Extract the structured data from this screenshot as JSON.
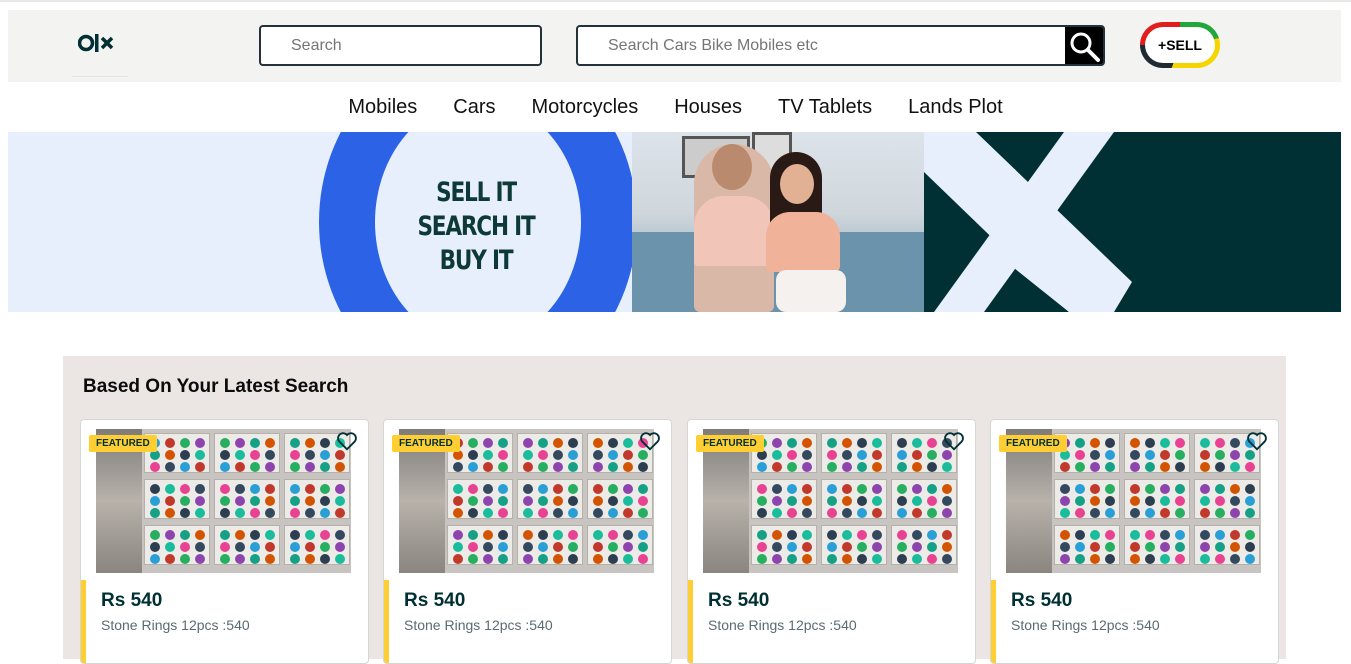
{
  "header": {
    "logo_alt": "OLX",
    "location_placeholder": "Search",
    "search_placeholder": "Search Cars Bike Mobiles etc",
    "sell_label": "+SELL",
    "icons": {
      "logo": "olx-logo-icon",
      "search": "search-icon"
    }
  },
  "categories": [
    "Mobiles",
    "Cars",
    "Motorcycles",
    "Houses",
    "TV Tablets",
    "Lands Plot"
  ],
  "banner": {
    "lines": [
      "SELL IT",
      "SEARCH IT",
      "BUY IT"
    ],
    "colors": {
      "ring": "#2c63e6",
      "background": "#e7effd",
      "x_panel": "#002f34",
      "text": "#0d3a36"
    }
  },
  "section": {
    "title": "Based On Your Latest Search",
    "cards": [
      {
        "badge": "FEATURED",
        "price": "Rs 540",
        "title": "Stone Rings 12pcs :540"
      },
      {
        "badge": "FEATURED",
        "price": "Rs 540",
        "title": "Stone Rings 12pcs :540"
      },
      {
        "badge": "FEATURED",
        "price": "Rs 540",
        "title": "Stone Rings 12pcs :540"
      },
      {
        "badge": "FEATURED",
        "price": "Rs 540",
        "title": "Stone Rings 12pcs :540"
      }
    ]
  },
  "colors": {
    "accent_yellow": "#ffce32",
    "brand_dark": "#002f34"
  }
}
